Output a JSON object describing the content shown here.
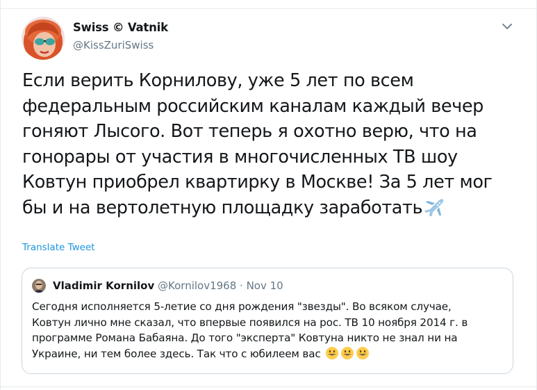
{
  "tweet": {
    "author_name": "Swiss © Vatnik",
    "author_handle": "@KissZuriSwiss",
    "text": "Если верить Корнилову, уже 5 лет по всем\nфедеральным российским каналам каждый вечер\nгоняют Лысого. Вот теперь я охотно верю, что на\nгонорары от участия в многочисленных ТВ шоу\nКовтун приобрел квартирку в Москве! За 5 лет мог\nбы и на вертолетную площадку заработать",
    "trailing_emoji": "airplane-icon",
    "translate_label": "Translate Tweet"
  },
  "quoted": {
    "author_name": "Vladimir Kornilov",
    "author_meta": "@Kornilov1968 · Nov 10",
    "text": "Сегодня исполняется 5-летие со дня рождения \"звезды\". Во всяком случае,\nКовтун лично мне сказал, что впервые появился на рос. ТВ 10 ноября 2014 г. в\nпрограмме Романа Бабаяна. До того \"эксперта\" Ковтуна никто не знал ни на\nУкраине, ни тем более здесь. Так что с юбилеем вас",
    "emojis": [
      "grinning-face-icon",
      "grinning-face-icon",
      "grinning-face-icon"
    ]
  },
  "colors": {
    "text": "#14171a",
    "secondary": "#657786",
    "link": "#1b95e0",
    "border": "#ccd6dd"
  }
}
